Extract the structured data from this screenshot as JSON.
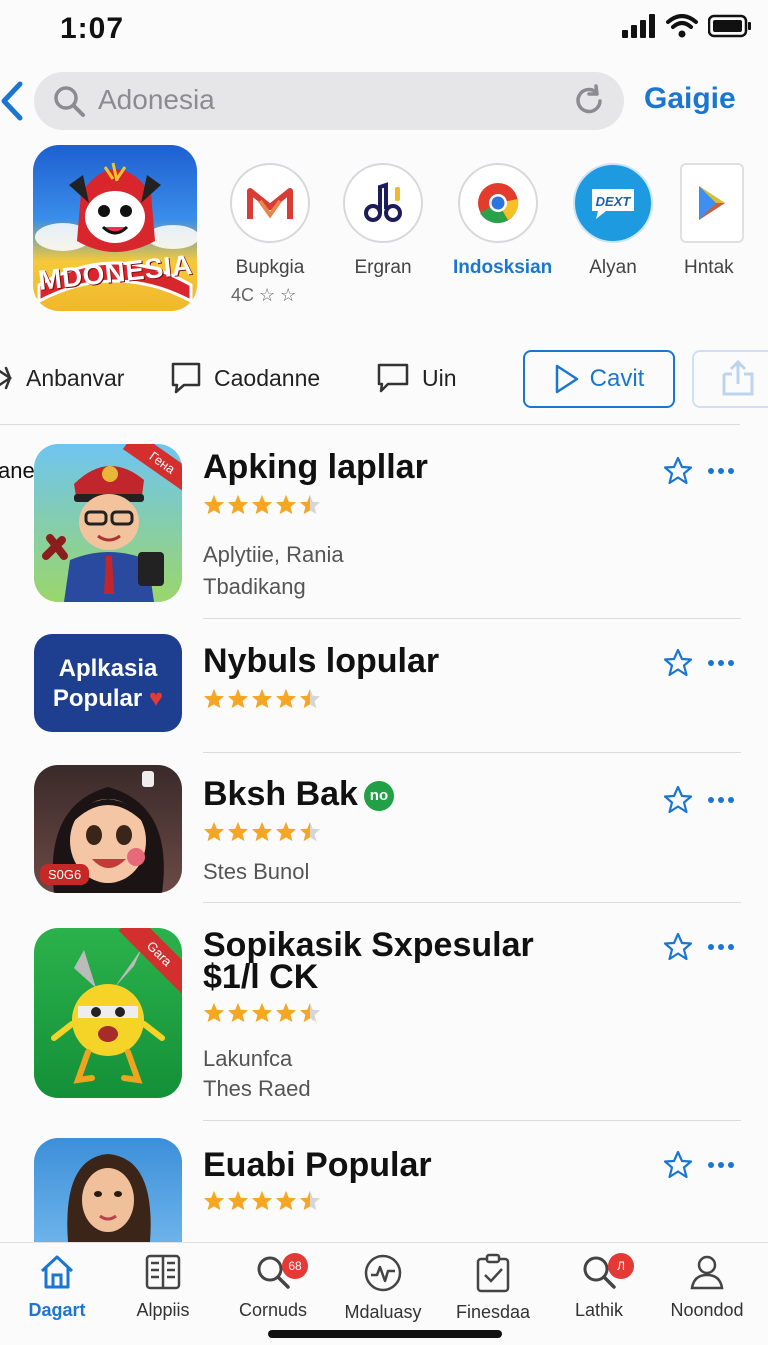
{
  "status": {
    "time": "1:07"
  },
  "search": {
    "query": "Adonesia",
    "go_label": "Gaigie"
  },
  "featured": {
    "label": "MDONESIA"
  },
  "mini_apps": [
    {
      "label": "Bupkgia",
      "rating_text": "4C ☆ ☆"
    },
    {
      "label": "Ergran"
    },
    {
      "label": "Indosksian"
    },
    {
      "label": "Alyan"
    },
    {
      "label": "Hntak"
    }
  ],
  "filters": {
    "chip1": "Anbanvar",
    "chip2": "Caodanne",
    "chip3": "Uin",
    "button": "Cavit"
  },
  "side_text": "ane",
  "apps": [
    {
      "title": "Apking lapllar",
      "sub1": "Aplytiie, Rania",
      "sub2": "Tbadikang",
      "rating": 4.5,
      "corner": "Гена"
    },
    {
      "title": "Nybuls lopular",
      "rating": 4.5,
      "icon_line1": "Aplkasia",
      "icon_line2": "Popular"
    },
    {
      "title": "Bksh Bak",
      "badge": "no",
      "sub1": "Stes Bunol",
      "rating": 4.5,
      "icon_tag": "S0G6"
    },
    {
      "title": "Sopikasik Sxpesular",
      "title2": "$1/l CK",
      "sub1": "Lakunfca",
      "sub2": "Thes Raed",
      "rating": 4.5,
      "corner": "Gara"
    },
    {
      "title": "Euabi Popular",
      "rating": 4.5
    }
  ],
  "tabs": [
    {
      "label": "Dagart",
      "active": true
    },
    {
      "label": "Alppiis"
    },
    {
      "label": "Cornuds",
      "badge": "68"
    },
    {
      "label": "Mdaluasy"
    },
    {
      "label": "Finesdaa"
    },
    {
      "label": "Lathik",
      "badge": "Л"
    },
    {
      "label": "Noondod"
    }
  ],
  "colors": {
    "accent": "#1a76d2",
    "star": "#f5a623",
    "badge_red": "#e53935"
  }
}
